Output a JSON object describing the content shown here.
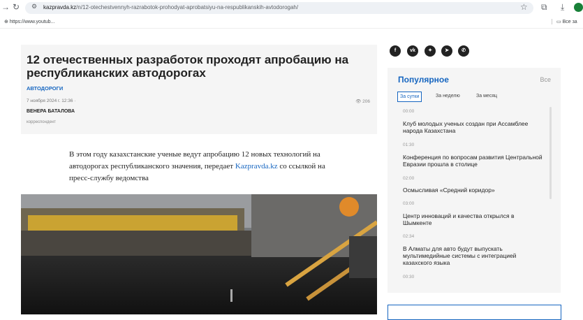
{
  "browser": {
    "url_host": "kazpravda.kz",
    "url_path": "/n/12-otechestvennyh-razrabotok-prohodyat-aprobatsiyu-na-respublikanskih-avtodorogah/",
    "bookmark_left": "https://www.youtub...",
    "bookmark_right": "Все за"
  },
  "article": {
    "title": "12 отечественных разработок проходят апробацию на республиканских автодорогах",
    "rubric": "АВТОДОРОГИ",
    "date": "7 ноября 2024 г. 12:36 ·",
    "views": "206",
    "author": "ВЕНЕРА БАТАЛОВА",
    "role": "корреспондент",
    "lead_before": "В этом году казахстанские ученые ведут апробацию 12 новых технологий на автодорогах республиканского значения, передает",
    "lead_link": "Kazpravda.kz",
    "lead_after": "со ссылкой на пресс-службу ведомства"
  },
  "share": [
    "f",
    "vk",
    "tw",
    "tg",
    "wa"
  ],
  "popular": {
    "title": "Популярное",
    "all": "Все",
    "tabs": [
      "За сутки",
      "За неделю",
      "За месяц"
    ],
    "items": [
      {
        "time": "00:00",
        "text": "Клуб молодых ученых создан при Ассамблее народа Казахстана"
      },
      {
        "time": "01:30",
        "text": "Конференция по вопросам развития Центральной Евразии прошла в столице"
      },
      {
        "time": "02:00",
        "text": "Осмысливая «Средний коридор»"
      },
      {
        "time": "03:00",
        "text": "Центр инноваций и качества открылся в Шымкенте"
      },
      {
        "time": "02:34",
        "text": "В Алматы для авто будут выпускать мультимедийные системы с интеграцией казахского языка"
      },
      {
        "time": "00:30",
        "text": ""
      }
    ]
  }
}
